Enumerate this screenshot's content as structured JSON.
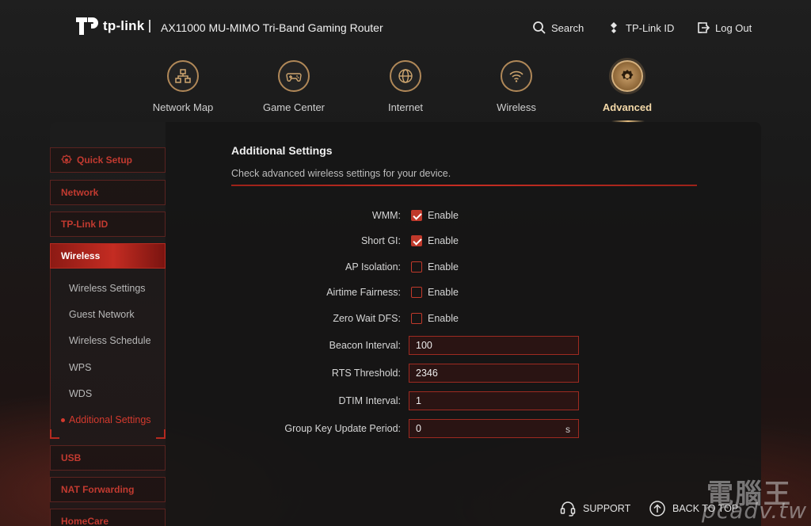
{
  "header": {
    "brand": "tp-link",
    "model": "AX11000 MU-MIMO Tri-Band Gaming Router",
    "search_label": "Search",
    "tplink_id_label": "TP-Link ID",
    "logout_label": "Log Out"
  },
  "nav": {
    "items": [
      {
        "label": "Network Map",
        "icon": "network-map-icon"
      },
      {
        "label": "Game Center",
        "icon": "gamepad-icon"
      },
      {
        "label": "Internet",
        "icon": "globe-icon"
      },
      {
        "label": "Wireless",
        "icon": "wifi-icon"
      },
      {
        "label": "Advanced",
        "icon": "gear-icon",
        "active": true
      }
    ]
  },
  "sidebar": {
    "items": [
      {
        "label": "Quick Setup"
      },
      {
        "label": "Network"
      },
      {
        "label": "TP-Link ID"
      },
      {
        "label": "Wireless",
        "active": true
      },
      {
        "label": "USB"
      },
      {
        "label": "NAT Forwarding"
      },
      {
        "label": "HomeCare"
      }
    ],
    "wireless_sub": [
      {
        "label": "Wireless Settings"
      },
      {
        "label": "Guest Network"
      },
      {
        "label": "Wireless Schedule"
      },
      {
        "label": "WPS"
      },
      {
        "label": "WDS"
      },
      {
        "label": "Additional Settings",
        "active": true
      }
    ]
  },
  "main": {
    "title": "Additional Settings",
    "description": "Check advanced wireless settings for your device.",
    "checkboxes": [
      {
        "label": "WMM:",
        "option": "Enable",
        "checked": true
      },
      {
        "label": "Short GI:",
        "option": "Enable",
        "checked": true
      },
      {
        "label": "AP Isolation:",
        "option": "Enable",
        "checked": false
      },
      {
        "label": "Airtime Fairness:",
        "option": "Enable",
        "checked": false
      },
      {
        "label": "Zero Wait DFS:",
        "option": "Enable",
        "checked": false
      }
    ],
    "fields": [
      {
        "label": "Beacon Interval:",
        "value": "100"
      },
      {
        "label": "RTS Threshold:",
        "value": "2346"
      },
      {
        "label": "DTIM Interval:",
        "value": "1"
      },
      {
        "label": "Group Key Update Period:",
        "value": "0",
        "unit": "s"
      }
    ]
  },
  "footer": {
    "support_label": "SUPPORT",
    "back_to_top_label": "BACK TO TOP"
  },
  "watermark": {
    "cn": "電腦王",
    "en": "pcadv.tw"
  },
  "colors": {
    "accent_red": "#c0392b",
    "accent_gold": "#caa06b",
    "background": "#1a1a1a"
  }
}
